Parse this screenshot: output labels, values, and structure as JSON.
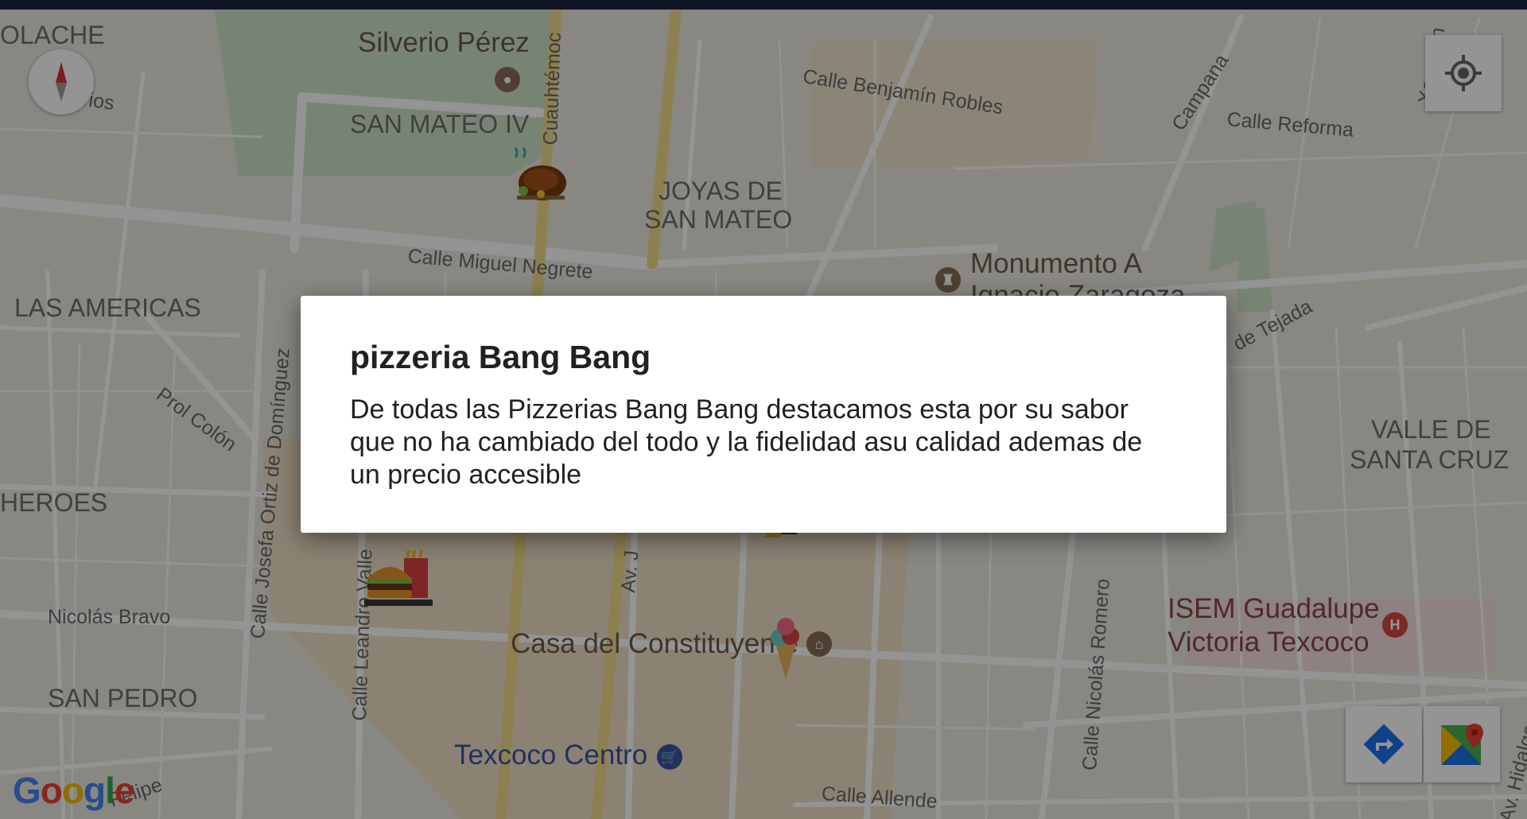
{
  "dialog": {
    "title": "pizzeria Bang Bang",
    "body": "De todas las Pizzerias Bang Bang destacamos esta por su sabor que no ha cambiado del todo y la fidelidad asu calidad ademas de un precio accesible"
  },
  "map": {
    "neighborhoods": {
      "hacienda": "OLACHE",
      "san_mateo_iv": "SAN MATEO IV",
      "joyas_1": "JOYAS DE",
      "joyas_2": "SAN MATEO",
      "las_americas": "LAS AMERICAS",
      "heroes": "HEROES",
      "san_pedro": "SAN PEDRO",
      "valle_1": "VALLE DE",
      "valle_2": "SANTA CRUZ"
    },
    "streets": {
      "lirios": "Lirios",
      "cuauhtemoc": "Cuauhtémoc",
      "benjamin": "Calle Benjamín Robles",
      "campana": "Campana",
      "reforma": "Calle Reforma",
      "xocotlan": "Xocotlán",
      "negrete": "Calle Miguel Negrete",
      "tejada": "de Tejada",
      "prol_colon": "Prol Colón",
      "josefa": "Calle Josefa Ortiz de Domínguez",
      "nicolas_bravo": "Nicolás Bravo",
      "leandro": "Calle Leandro Valle",
      "av_j": "Av. J",
      "nicolas_romero": "Calle Nicolás Romero",
      "felipe": "Felipe",
      "allende": "Calle Allende",
      "av_hidalgo": "Av. Hidalgo"
    },
    "pois": {
      "silverio": "Silverio Pérez",
      "monumento_1": "Monumento A",
      "monumento_2": "Ignacio Zaragoza",
      "casa": "Casa del Constituyente",
      "texcoco": "Texcoco Centro",
      "isem_1": "ISEM Guadalupe",
      "isem_2": "Victoria Texcoco"
    },
    "google_logo": "Google"
  },
  "colors": {
    "scrim": "rgba(0,0,0,0.42)",
    "poi_blue": "#3a55a4",
    "hospital_red": "#d64541"
  },
  "icons": {
    "compass": "compass-icon",
    "my_location": "my-location-icon",
    "directions": "directions-icon",
    "maps_app": "google-maps-icon"
  }
}
